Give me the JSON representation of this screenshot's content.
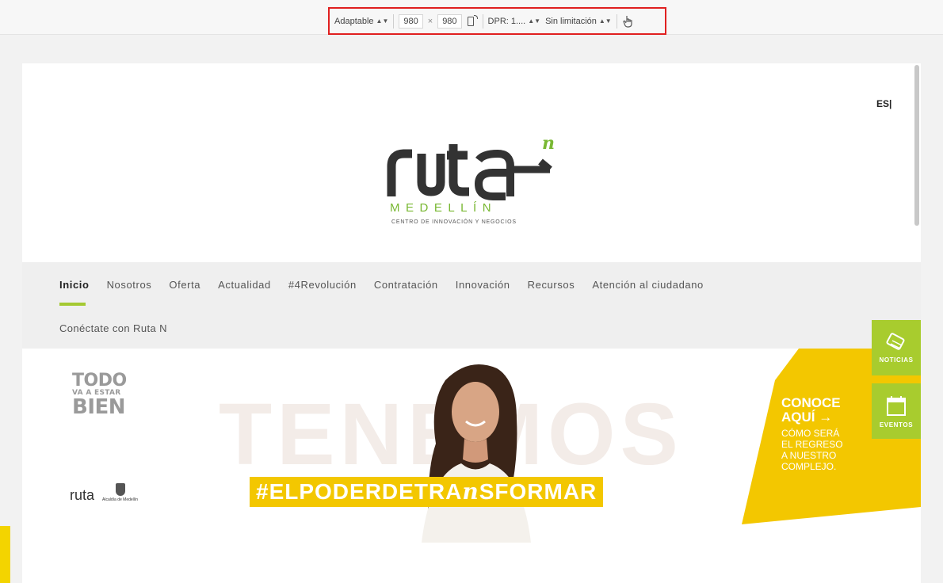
{
  "device_toolbar": {
    "device": "Adaptable",
    "width": "980",
    "times": "×",
    "height": "980",
    "dpr": "DPR: 1....",
    "throttle": "Sin limitación"
  },
  "header": {
    "lang": "ES|",
    "logo": {
      "word": "ruta",
      "superscript": "n",
      "city": "MEDELLÍN",
      "tagline": "CENTRO DE INNOVACIÓN Y NEGOCIOS"
    }
  },
  "nav": {
    "items": [
      {
        "label": "Inicio",
        "active": true
      },
      {
        "label": "Nosotros"
      },
      {
        "label": "Oferta"
      },
      {
        "label": "Actualidad"
      },
      {
        "label": "#4Revolución"
      },
      {
        "label": "Contratación"
      },
      {
        "label": "Innovación"
      },
      {
        "label": "Recursos"
      },
      {
        "label": "Atención al ciudadano"
      }
    ],
    "second_row": "Conéctate con Ruta N"
  },
  "hero": {
    "todo": [
      "TODO",
      "VA A ESTAR",
      "BIEN"
    ],
    "background_word": "TENEMOS",
    "hashtag_pre": "#ELPODERDETRA",
    "hashtag_n": "n",
    "hashtag_post": "SFORMAR",
    "mini_logo": "ruta",
    "alcaldia": "Alcaldía de Medellín",
    "promo_title_1": "CONOCE",
    "promo_title_2": "AQUÍ →",
    "promo_sub": [
      "CÓMO SERÁ",
      "EL REGRESO",
      "A NUESTRO",
      "COMPLEJO."
    ]
  },
  "side": {
    "noticias": "NOTICIAS",
    "eventos": "EVENTOS"
  },
  "colors": {
    "accent_green": "#a8cc2e",
    "logo_green": "#79b833",
    "promo_yellow": "#f3c700",
    "highlight_red": "#e02020"
  }
}
